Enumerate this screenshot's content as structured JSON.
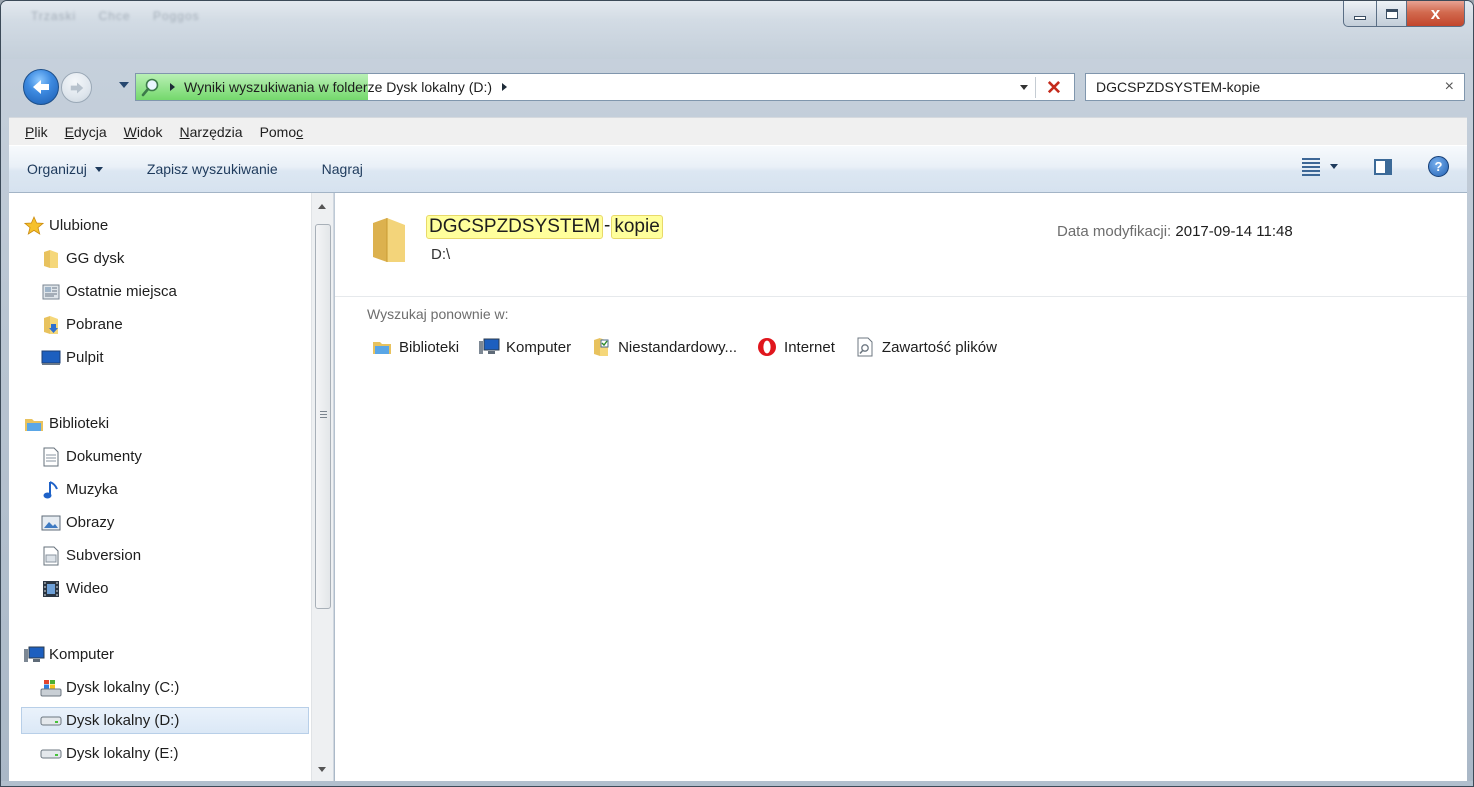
{
  "titlebar": {
    "blurred_menu": [
      "Trzaski",
      "Chce",
      "Poggos"
    ],
    "caption_close": "x"
  },
  "address": {
    "location_highlight": "Wyniki wyszukiwania",
    "location_rest": "w folderze Dysk lokalny (D:)",
    "stop_glyph": "✕"
  },
  "search": {
    "query": "DGCSPZDSYSTEM-kopie",
    "clear_glyph": "×"
  },
  "menu": {
    "plik_u": "P",
    "plik_r": "lik",
    "edycja_u": "E",
    "edycja_r": "dycja",
    "widok_u": "W",
    "widok_r": "idok",
    "narzedzia_u": "N",
    "narzedzia_r": "arzędzia",
    "pomoc_l": "Pomo",
    "pomoc_u": "c"
  },
  "commands": {
    "organize": "Organizuj",
    "save_search": "Zapisz wyszukiwanie",
    "burn": "Nagraj",
    "help_glyph": "?"
  },
  "nav": {
    "favorites": "Ulubione",
    "gg_disk": "GG dysk",
    "recent": "Ostatnie miejsca",
    "downloads": "Pobrane",
    "desktop": "Pulpit",
    "libraries": "Biblioteki",
    "documents": "Dokumenty",
    "music": "Muzyka",
    "pictures": "Obrazy",
    "subversion": "Subversion",
    "video": "Wideo",
    "computer": "Komputer",
    "drive_c": "Dysk lokalny (C:)",
    "drive_d": "Dysk lokalny (D:)",
    "drive_e": "Dysk lokalny (E:)"
  },
  "result": {
    "name_part1": "DGCSPZDSYSTEM",
    "name_dash": "-",
    "name_part2": "kopie",
    "path": "D:\\",
    "date_label": "Data modyfikacji:",
    "date_value": "2017-09-14 11:48"
  },
  "search_again": {
    "label": "Wyszukaj ponownie w:",
    "libraries": "Biblioteki",
    "computer": "Komputer",
    "custom": "Niestandardowy...",
    "internet": "Internet",
    "file_contents": "Zawartość plików"
  },
  "colors": {
    "progress_green": "#74d86c",
    "highlight_yellow": "#ffff9c",
    "selected_blue": "#dbe8f6"
  }
}
